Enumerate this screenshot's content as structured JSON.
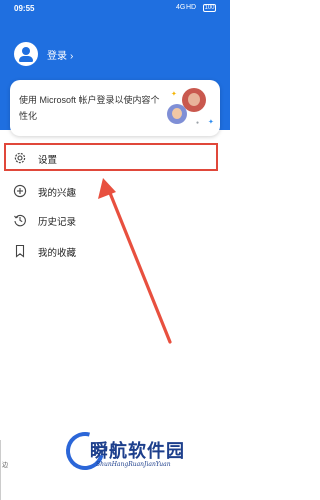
{
  "status_bar": {
    "time": "09:55",
    "network": "4G",
    "signal": "HD",
    "battery": "100"
  },
  "header": {
    "login_label": "登录",
    "chevron": "›"
  },
  "promo_card": {
    "text": "使用 Microsoft 帐户登录以使内容个性化"
  },
  "menu": {
    "items": [
      {
        "label": "设置",
        "icon": "gear-icon"
      },
      {
        "label": "我的兴趣",
        "icon": "plus-circle-icon"
      },
      {
        "label": "历史记录",
        "icon": "history-icon"
      },
      {
        "label": "我的收藏",
        "icon": "bookmark-icon"
      }
    ]
  },
  "watermark": {
    "brand": "瞬航软件园",
    "brand_sub": "ShunHangRuanJianYuan"
  },
  "edge": {
    "text": "边"
  },
  "colors": {
    "header_blue": "#1f6fe0",
    "highlight_red": "#e0473a",
    "arrow_red": "#e8503f"
  }
}
